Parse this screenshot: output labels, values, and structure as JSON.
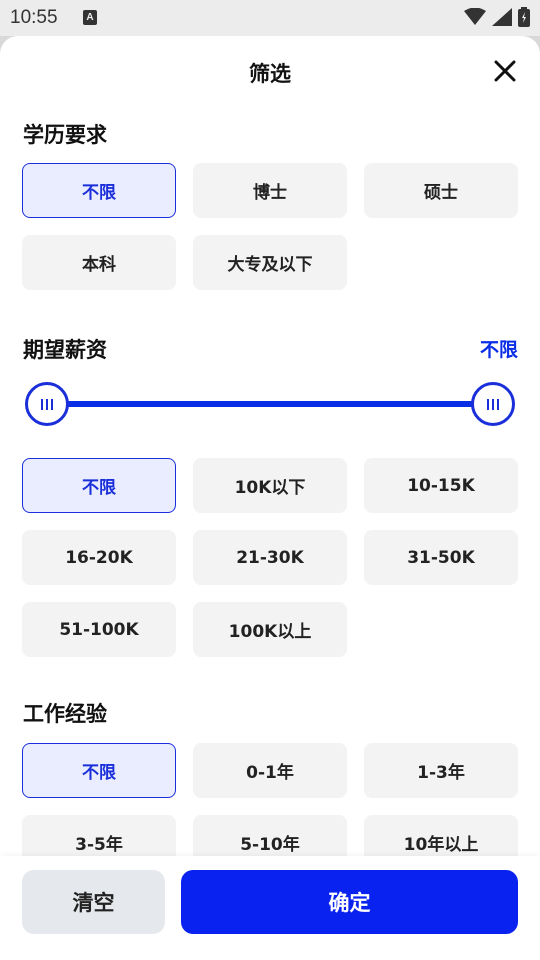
{
  "status": {
    "time": "10:55",
    "a_badge": "A"
  },
  "sheet": {
    "title": "筛选"
  },
  "education": {
    "title": "学历要求",
    "options": [
      "不限",
      "博士",
      "硕士",
      "本科",
      "大专及以下"
    ],
    "selected_index": 0
  },
  "salary": {
    "title": "期望薪资",
    "value": "不限",
    "range_low": 0,
    "range_high": 1,
    "options": [
      "不限",
      "10K以下",
      "10-15K",
      "16-20K",
      "21-30K",
      "31-50K",
      "51-100K",
      "100K以上"
    ],
    "selected_index": 0
  },
  "experience": {
    "title": "工作经验",
    "options": [
      "不限",
      "0-1年",
      "1-3年",
      "3-5年",
      "5-10年",
      "10年以上"
    ],
    "selected_index": 0
  },
  "actions": {
    "clear": "清空",
    "confirm": "确定"
  },
  "colors": {
    "accent": "#0a22f0",
    "selected_bg": "#eaecff",
    "chip_bg": "#f3f3f3"
  }
}
